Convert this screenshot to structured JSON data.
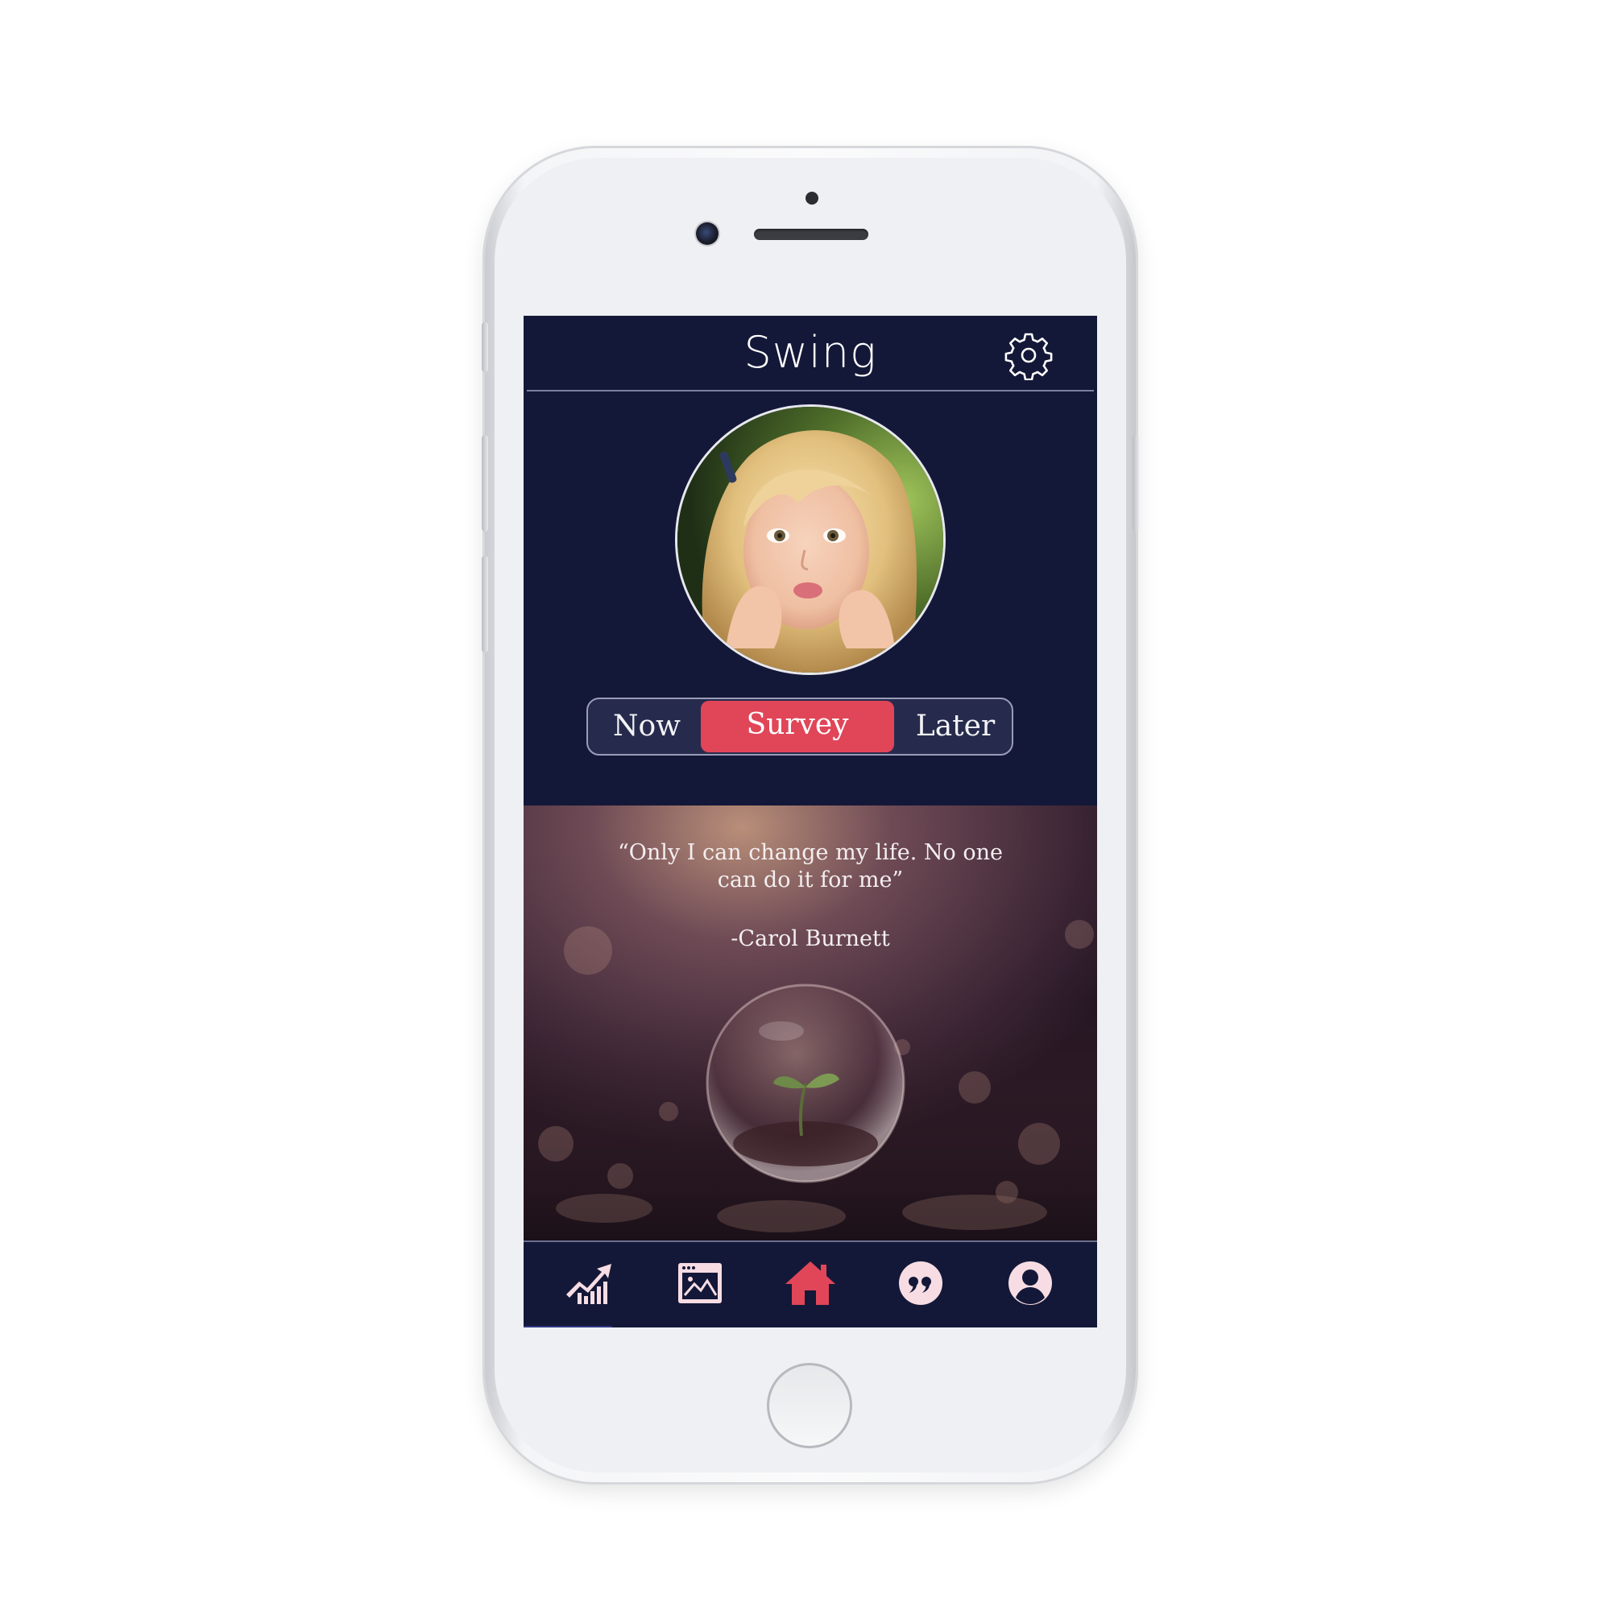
{
  "app": {
    "title": "Swing",
    "settings_icon": "gear-icon"
  },
  "profile": {
    "avatar_alt": "profile photo"
  },
  "segmented_control": {
    "options": [
      "Now",
      "Survey",
      "Later"
    ],
    "selected": "Survey"
  },
  "quote": {
    "text": "“Only I can change my life. No one can do it for me”",
    "author": "-Carol Burnett"
  },
  "tabbar": {
    "items": [
      {
        "icon": "chart-growth-icon",
        "active": false
      },
      {
        "icon": "gallery-icon",
        "active": false
      },
      {
        "icon": "home-icon",
        "active": true
      },
      {
        "icon": "quote-icon",
        "active": false
      },
      {
        "icon": "profile-icon",
        "active": false
      }
    ]
  },
  "colors": {
    "background": "#141838",
    "accent": "#e04658",
    "tab_icon": "#f7dde3",
    "active_tab_icon": "#e04658"
  }
}
